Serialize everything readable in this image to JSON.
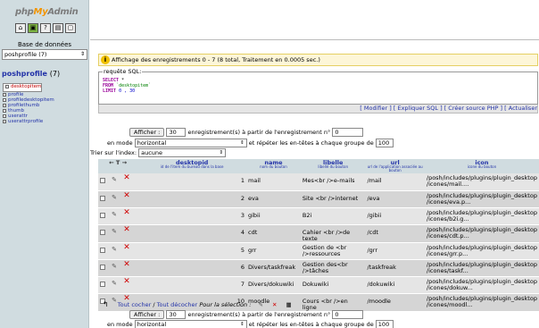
{
  "left": {
    "logo": {
      "php": "php",
      "my": "My",
      "admin": "Admin"
    },
    "icons": [
      "home-icon",
      "sql-icon",
      "docs-icon",
      "query-icon",
      "window-icon"
    ],
    "icon_glyphs": [
      "⌂",
      "▣",
      "?",
      "▤",
      "▢"
    ],
    "db_label": "Base de données",
    "db_select": "poshprofile (7)",
    "db_title": "poshprofile",
    "db_count": "(7)",
    "tables": [
      "desktopitem",
      "profile",
      "profiledesktopitem",
      "profilethumb",
      "thumb",
      "userattr",
      "userattrprofile"
    ]
  },
  "notice": {
    "icon": "info-icon",
    "text": "Affichage des enregistrements 0 - 7 (8 total, Traitement en 0.0005 sec.)"
  },
  "sql": {
    "legend": "requête SQL:",
    "select": "SELECT",
    "star": " *",
    "from": "FROM",
    "table": "`desktopitem`",
    "limit": "LIMIT",
    "limit_vals": "0 , 30"
  },
  "sql_links": {
    "modifier": "[ Modifier ]",
    "expliquer": "[ Expliquer SQL ]",
    "creer": "[ Créer source PHP ]",
    "actualiser": "[ Actualiser"
  },
  "nav_top": {
    "show_button": "Afficher :",
    "rows": "30",
    "text1": "enregistrement(s) à partir de l'enregistrement n°",
    "start": "0",
    "mode_label": "en mode",
    "mode": "horizontal",
    "text2": "et répéter les en-têtes à chaque groupe de",
    "repeat": "100",
    "sort_label": "Trier sur l'index:",
    "sort_value": "aucune"
  },
  "table": {
    "headers": [
      {
        "name": "desktopid",
        "sub": "id de l'item du bureau dans la base"
      },
      {
        "name": "name",
        "sub": "nom du bouton"
      },
      {
        "name": "libelle",
        "sub": "libellé du bouton"
      },
      {
        "name": "url",
        "sub": "url de l'application associée au bouton"
      },
      {
        "name": "icon",
        "sub": "icone du bouton"
      }
    ],
    "rows": [
      {
        "id": "1",
        "name": "mail",
        "libelle": "Mes<br />e-mails",
        "url": "/mail",
        "icon": "/posh/includes/plugins/plugin_desktop /icones/mail...."
      },
      {
        "id": "2",
        "name": "eva",
        "libelle": "Site <br />internet",
        "url": "/eva",
        "icon": "/posh/includes/plugins/plugin_desktop /icones/eva.p..."
      },
      {
        "id": "3",
        "name": "gibii",
        "libelle": "B2i",
        "url": "/gibii",
        "icon": "/posh/includes/plugins/plugin_desktop /icones/b2i.g..."
      },
      {
        "id": "4",
        "name": "cdt",
        "libelle": "Cahier <br />de texte",
        "url": "/cdt",
        "icon": "/posh/includes/plugins/plugin_desktop /icones/cdt.p..."
      },
      {
        "id": "5",
        "name": "grr",
        "libelle": "Gestion de <br />ressources",
        "url": "/grr",
        "icon": "/posh/includes/plugins/plugin_desktop /icones/grr.p..."
      },
      {
        "id": "6",
        "name": "Divers/taskfreak",
        "libelle": "Gestion des<br />tâches",
        "url": "/taskfreak",
        "icon": "/posh/includes/plugins/plugin_desktop /icones/taskf..."
      },
      {
        "id": "7",
        "name": "Divers/dokuwiki",
        "libelle": "Dokuwiki",
        "url": "/dokuwiki",
        "icon": "/posh/includes/plugins/plugin_desktop /icones/dokuw..."
      },
      {
        "id": "10",
        "name": "moodle",
        "libelle": "Cours <br />en ligne",
        "url": "/moodle",
        "icon": "/posh/includes/plugins/plugin_desktop /icones/moodl..."
      }
    ]
  },
  "bottom": {
    "check_all": "Tout cocher",
    "sep": " / ",
    "uncheck_all": "Tout décocher",
    "selection": "Pour la sélection :"
  },
  "colors": {
    "header_bg": "#d0dce0",
    "row_odd": "#e5e5e5",
    "row_even": "#d5d5d5",
    "link": "#2232a8",
    "delete": "#d00000"
  }
}
